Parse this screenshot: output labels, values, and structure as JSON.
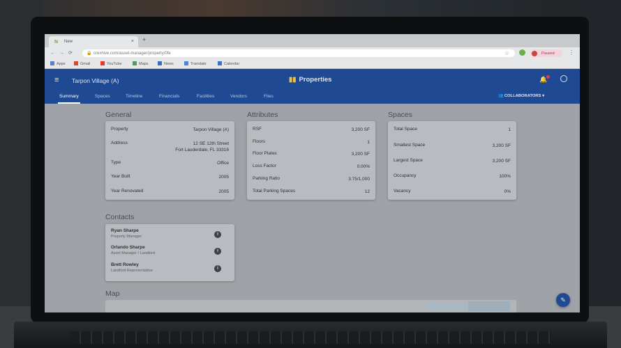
{
  "browser": {
    "tab_title": "New",
    "tab_close": "×",
    "new_tab": "+",
    "url": "crexhive.com/asset-manager/property/0fe",
    "profile_status": "Paused",
    "profile_initial": "S",
    "bookmarks": [
      "Apps",
      "Gmail",
      "YouTube",
      "Maps",
      "News",
      "Translate",
      "Calendar"
    ]
  },
  "header": {
    "project_name": "Tarpon Village (A)",
    "app_name": "Properties",
    "tabs": [
      "Summary",
      "Spaces",
      "Timeline",
      "Financials",
      "Facilities",
      "Vendors",
      "Files"
    ],
    "collaborators_label": "COLLABORATORS"
  },
  "general": {
    "title": "General",
    "rows": [
      {
        "label": "Property",
        "value": "Tarpon Village (A)"
      },
      {
        "label": "Address",
        "value": "12 SE 12th Street",
        "value2": "Fort Lauderdale, FL 33316"
      },
      {
        "label": "Type",
        "value": "Office"
      },
      {
        "label": "Year Built",
        "value": "2005"
      },
      {
        "label": "Year Renovated",
        "value": "2005"
      }
    ]
  },
  "attributes": {
    "title": "Attributes",
    "rows": [
      {
        "label": "RSF",
        "value": "3,200 SF"
      },
      {
        "label": "Floors",
        "value": "1"
      },
      {
        "label": "Floor Plates",
        "value": "3,200 SF"
      },
      {
        "label": "Loss Factor",
        "value": "0.00%"
      },
      {
        "label": "Parking Ratio",
        "value": "3.75/1,000"
      },
      {
        "label": "Total Parking Spaces",
        "value": "12"
      }
    ]
  },
  "spaces": {
    "title": "Spaces",
    "rows": [
      {
        "label": "Total Space",
        "value": "1"
      },
      {
        "label": "Smallest Space",
        "value": "3,200 SF"
      },
      {
        "label": "Largest Space",
        "value": "3,200 SF"
      },
      {
        "label": "Occupancy",
        "value": "100%"
      },
      {
        "label": "Vacancy",
        "value": "0%"
      }
    ]
  },
  "contacts": {
    "title": "Contacts",
    "items": [
      {
        "name": "Ryan Sharpe",
        "role": "Property Manager"
      },
      {
        "name": "Orlando Sharpe",
        "role": "Asset Manager / Landlord"
      },
      {
        "name": "Brett Rowley",
        "role": "Landlord Representative"
      }
    ]
  },
  "map": {
    "title": "Map"
  },
  "colors": {
    "primary": "#1f4a93",
    "accent": "#f2c23a"
  }
}
